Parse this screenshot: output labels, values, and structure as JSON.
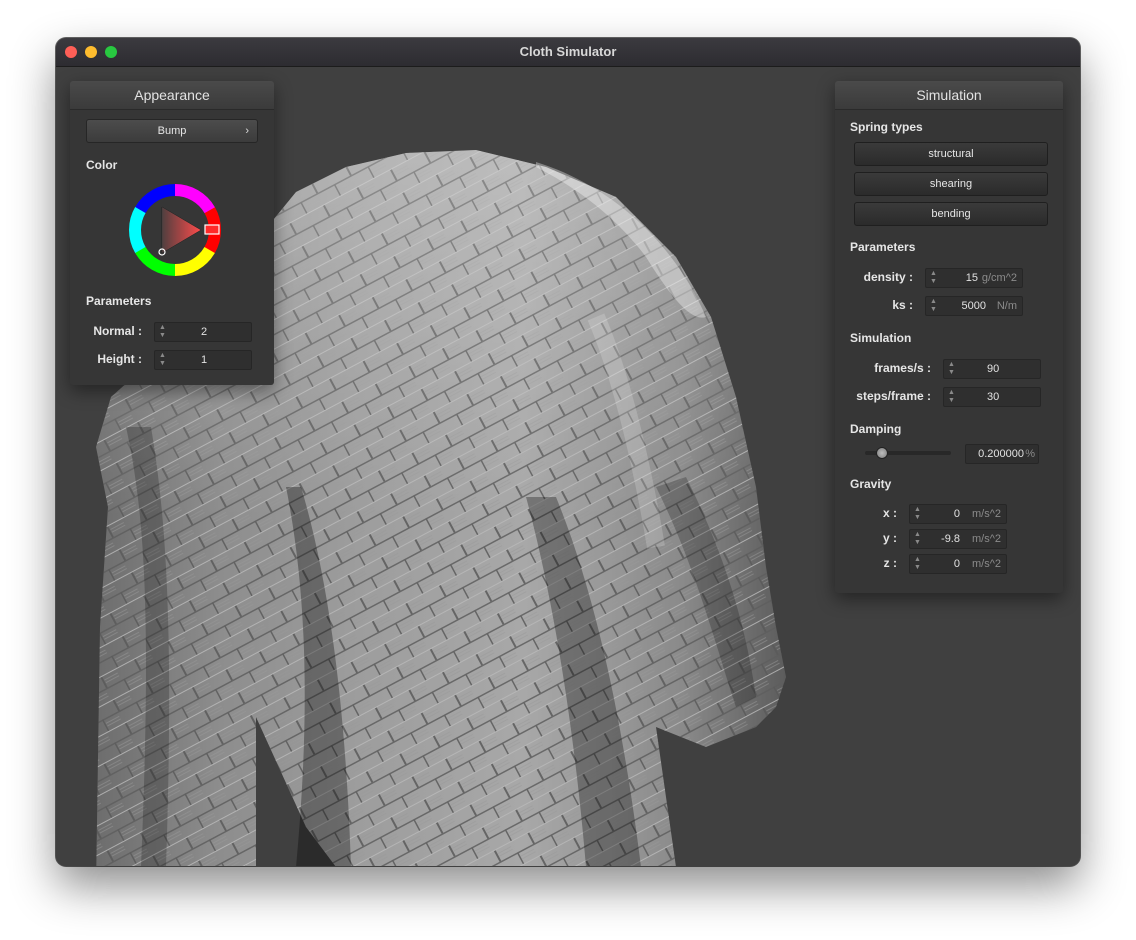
{
  "window": {
    "title": "Cloth Simulator"
  },
  "appearance": {
    "title": "Appearance",
    "shader": "Bump",
    "color_label": "Color",
    "selected_color": "#ff2020",
    "params_label": "Parameters",
    "normal_label": "Normal :",
    "normal_value": "2",
    "height_label": "Height :",
    "height_value": "1"
  },
  "simulation": {
    "title": "Simulation",
    "spring_types_label": "Spring types",
    "springs": [
      "structural",
      "shearing",
      "bending"
    ],
    "params_label": "Parameters",
    "density_label": "density :",
    "density_value": "15",
    "density_unit": "g/cm^2",
    "ks_label": "ks :",
    "ks_value": "5000",
    "ks_unit": "N/m",
    "sim_label": "Simulation",
    "fps_label": "frames/s :",
    "fps_value": "90",
    "steps_label": "steps/frame :",
    "steps_value": "30",
    "damping_label": "Damping",
    "damping_value": "0.200000",
    "damping_unit": "%",
    "damping_fraction": 0.2,
    "gravity_label": "Gravity",
    "gx_label": "x :",
    "gx_value": "0",
    "gy_label": "y :",
    "gy_value": "-9.8",
    "gz_label": "z :",
    "gz_value": "0",
    "gravity_unit": "m/s^2"
  }
}
